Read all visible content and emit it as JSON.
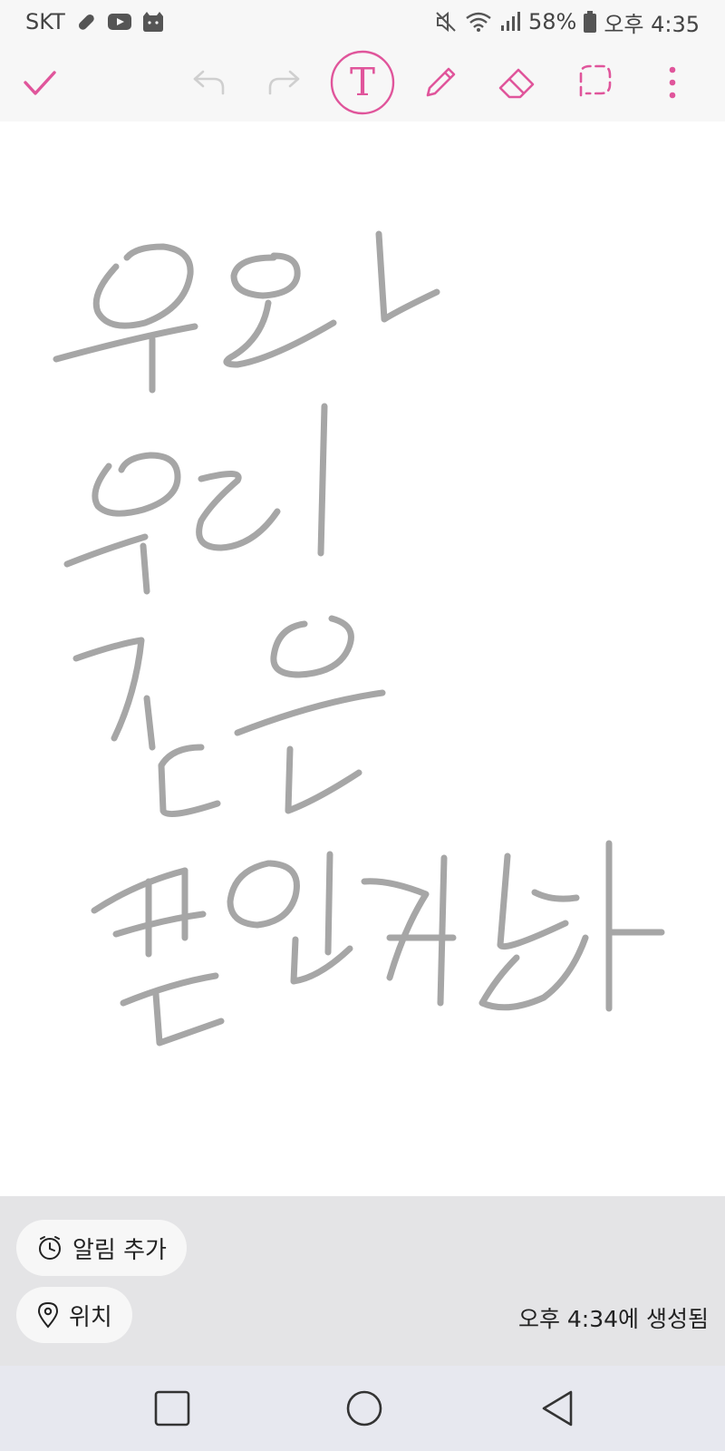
{
  "status_bar": {
    "carrier": "SKT",
    "battery_percent": "58%",
    "time": "오후 4:35",
    "icons": [
      "pill-icon",
      "youtube-icon",
      "cat-icon",
      "mute-icon",
      "wifi-icon",
      "signal-icon",
      "battery-icon"
    ]
  },
  "toolbar": {
    "icons": [
      "check-icon",
      "undo-icon",
      "redo-icon",
      "text-tool-icon",
      "pen-icon",
      "eraser-icon",
      "lasso-icon",
      "more-icon"
    ],
    "text_tool_glyph": "T",
    "accent_color": "#e0559b",
    "disabled_color": "#cfcfcf"
  },
  "canvas": {
    "handwriting_lines": [
      "우와",
      "우리",
      "같은",
      "폰인가봐"
    ],
    "ink_color": "#a6a6a6"
  },
  "info_panel": {
    "reminder_label": "알림 추가",
    "location_label": "위치",
    "created_text": "오후 4:34에 생성됨"
  },
  "nav_bar": {
    "icons": [
      "recent-apps-icon",
      "home-icon",
      "back-icon"
    ]
  }
}
